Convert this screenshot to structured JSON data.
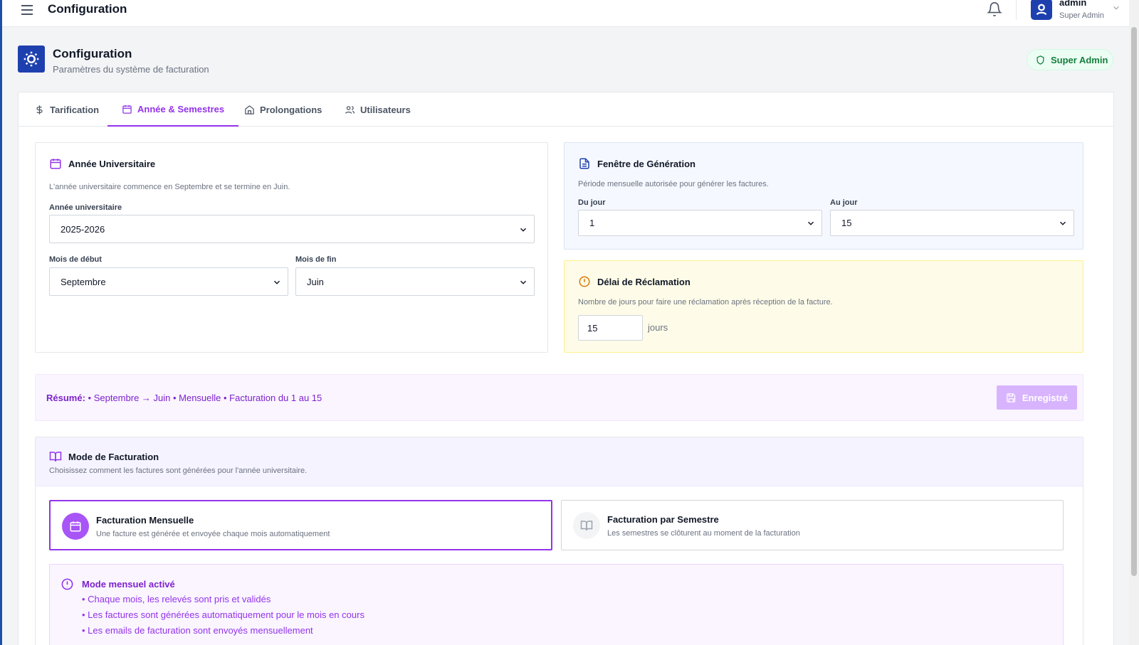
{
  "header": {
    "app_title": "Configuration",
    "user": {
      "name": "admin",
      "role": "Super Admin"
    }
  },
  "page": {
    "title": "Configuration",
    "subtitle": "Paramètres du système de facturation",
    "role_badge": "Super Admin"
  },
  "tabs": [
    {
      "label": "Tarification",
      "icon": "dollar-icon",
      "active": false
    },
    {
      "label": "Année & Semestres",
      "icon": "calendar-icon",
      "active": true
    },
    {
      "label": "Prolongations",
      "icon": "home-icon",
      "active": false
    },
    {
      "label": "Utilisateurs",
      "icon": "users-icon",
      "active": false
    }
  ],
  "academic_year": {
    "title": "Année Universitaire",
    "description": "L'année universitaire commence en Septembre et se termine en Juin.",
    "year_label": "Année universitaire",
    "year_value": "2025-2026",
    "start_label": "Mois de début",
    "start_value": "Septembre",
    "end_label": "Mois de fin",
    "end_value": "Juin"
  },
  "generation_window": {
    "title": "Fenêtre de Génération",
    "description": "Période mensuelle autorisée pour générer les factures.",
    "from_label": "Du jour",
    "from_value": "1",
    "to_label": "Au jour",
    "to_value": "15"
  },
  "claim_delay": {
    "title": "Délai de Réclamation",
    "description": "Nombre de jours pour faire une réclamation après réception de la facture.",
    "value": "15",
    "unit": "jours"
  },
  "summary": {
    "label": "Résumé:",
    "text": "• Septembre → Juin • Mensuelle • Facturation du 1 au 15",
    "save_label": "Enregistré"
  },
  "billing_mode": {
    "title": "Mode de Facturation",
    "description": "Choisissez comment les factures sont générées pour l'année universitaire.",
    "options": [
      {
        "title": "Facturation Mensuelle",
        "description": "Une facture est générée et envoyée chaque mois automatiquement",
        "selected": true
      },
      {
        "title": "Facturation par Semestre",
        "description": "Les semestres se clôturent au moment de la facturation",
        "selected": false
      }
    ],
    "info": {
      "title": "Mode mensuel activé",
      "items": [
        "• Chaque mois, les relevés sont pris et validés",
        "• Les factures sont générées automatiquement pour le mois en cours",
        "• Les emails de facturation sont envoyés mensuellement"
      ]
    }
  },
  "colors": {
    "primary": "#1e40af",
    "accent": "#9333ea",
    "success": "#15803d",
    "warning": "#d97706"
  }
}
